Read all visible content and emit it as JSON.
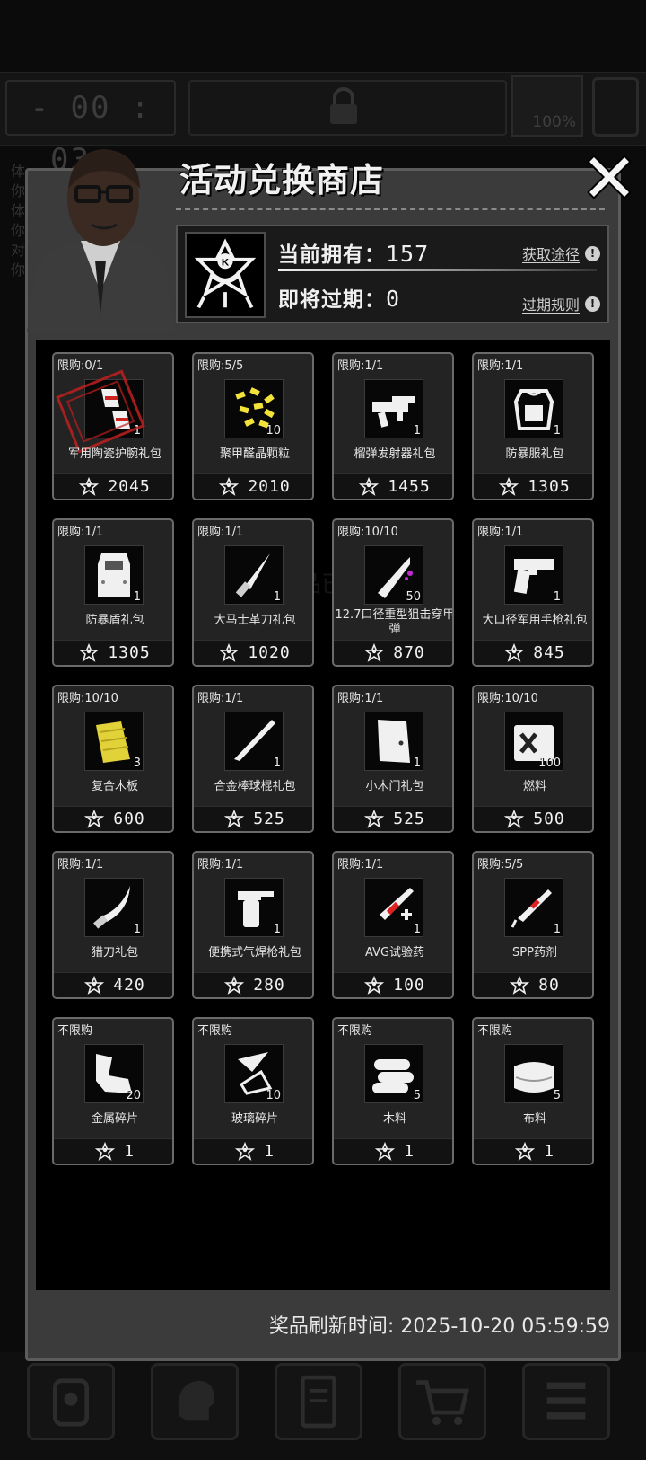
{
  "hud": {
    "timer": "- 00 : 03 -",
    "battery": "100%",
    "side_text": "体你体你对你"
  },
  "modal": {
    "title": "活动兑换商店",
    "close_icon": "close-icon"
  },
  "currency": {
    "owned_label": "当前拥有：",
    "owned_value": "157",
    "expiring_label": "即将过期：",
    "expiring_value": "0",
    "obtain_link": "获取途径",
    "expire_rule_link": "过期规则"
  },
  "items": [
    {
      "limit": "限购:0/1",
      "qty": "1",
      "name": "军用陶瓷护腕礼包",
      "price": "2045",
      "icon": "bracer-icon",
      "sold_out": true
    },
    {
      "limit": "限购:5/5",
      "qty": "10",
      "name": "聚甲醛晶颗粒",
      "price": "2010",
      "icon": "granules-icon"
    },
    {
      "limit": "限购:1/1",
      "qty": "1",
      "name": "榴弹发射器礼包",
      "price": "1455",
      "icon": "grenade-launcher-icon"
    },
    {
      "limit": "限购:1/1",
      "qty": "1",
      "name": "防暴服礼包",
      "price": "1305",
      "icon": "riot-suit-icon"
    },
    {
      "limit": "限购:1/1",
      "qty": "1",
      "name": "防暴盾礼包",
      "price": "1305",
      "icon": "riot-shield-icon"
    },
    {
      "limit": "限购:1/1",
      "qty": "1",
      "name": "大马士革刀礼包",
      "price": "1020",
      "icon": "damascus-knife-icon"
    },
    {
      "limit": "限购:10/10",
      "qty": "50",
      "name": "12.7口径重型狙击穿甲弹",
      "price": "870",
      "icon": "sniper-round-icon"
    },
    {
      "limit": "限购:1/1",
      "qty": "1",
      "name": "大口径军用手枪礼包",
      "price": "845",
      "icon": "pistol-icon"
    },
    {
      "limit": "限购:10/10",
      "qty": "3",
      "name": "复合木板",
      "price": "600",
      "icon": "plywood-icon"
    },
    {
      "limit": "限购:1/1",
      "qty": "1",
      "name": "合金棒球棍礼包",
      "price": "525",
      "icon": "baseball-bat-icon"
    },
    {
      "limit": "限购:1/1",
      "qty": "1",
      "name": "小木门礼包",
      "price": "525",
      "icon": "wooden-door-icon"
    },
    {
      "limit": "限购:10/10",
      "qty": "100",
      "name": "燃料",
      "price": "500",
      "icon": "fuel-can-icon"
    },
    {
      "limit": "限购:1/1",
      "qty": "1",
      "name": "猎刀礼包",
      "price": "420",
      "icon": "hunting-knife-icon"
    },
    {
      "limit": "限购:1/1",
      "qty": "1",
      "name": "便携式气焊枪礼包",
      "price": "280",
      "icon": "blowtorch-icon"
    },
    {
      "limit": "限购:1/1",
      "qty": "1",
      "name": "AVG试验药",
      "price": "100",
      "icon": "syringe-icon"
    },
    {
      "limit": "限购:5/5",
      "qty": "1",
      "name": "SPP药剂",
      "price": "80",
      "icon": "injector-icon"
    },
    {
      "limit": "不限购",
      "qty": "20",
      "name": "金属碎片",
      "price": "1",
      "icon": "metal-scrap-icon"
    },
    {
      "limit": "不限购",
      "qty": "10",
      "name": "玻璃碎片",
      "price": "1",
      "icon": "glass-shard-icon"
    },
    {
      "limit": "不限购",
      "qty": "5",
      "name": "木料",
      "price": "1",
      "icon": "logs-icon"
    },
    {
      "limit": "不限购",
      "qty": "5",
      "name": "布料",
      "price": "1",
      "icon": "cloth-icon"
    }
  ],
  "ghost_text": "当前物品已售罄",
  "refresh": {
    "label": "奖品刷新时间:",
    "time": "2025-10-20 05:59:59"
  },
  "bottom_nav": [
    "backpack-icon",
    "brain-icon",
    "notebook-icon",
    "shop-cart-icon",
    "menu-list-icon"
  ]
}
